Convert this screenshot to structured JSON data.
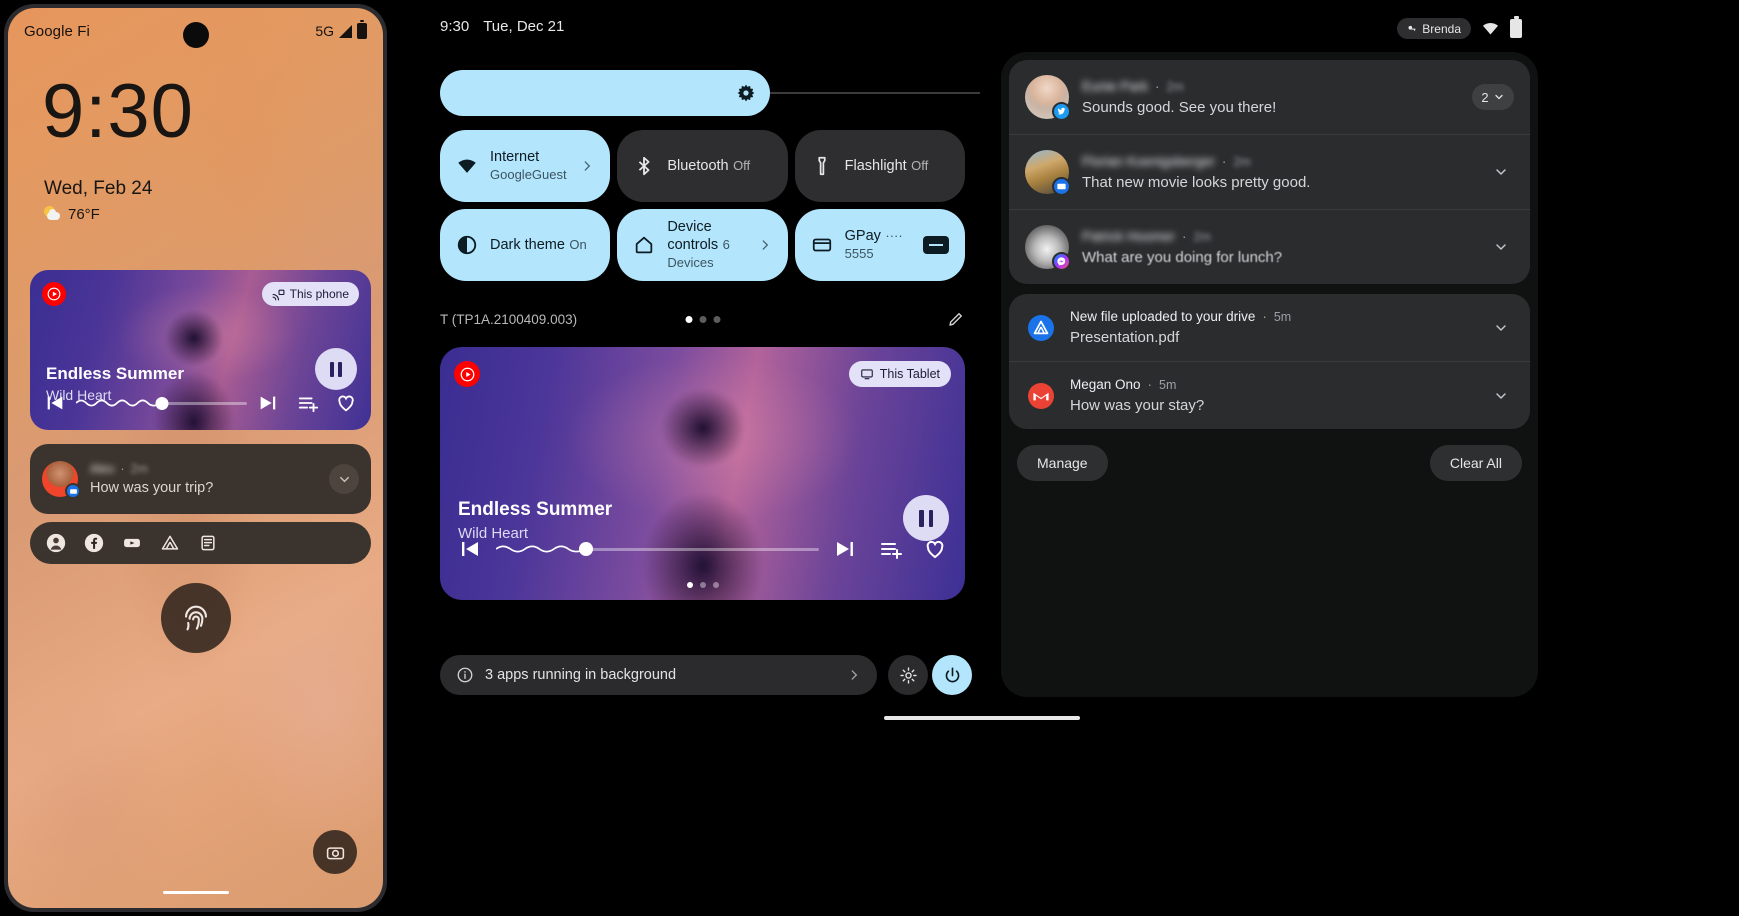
{
  "phone": {
    "status": {
      "carrier": "Google Fi",
      "network": "5G"
    },
    "lock": {
      "time": "9:30",
      "date": "Wed, Feb 24",
      "temperature": "76°F"
    },
    "media": {
      "source_icon": "youtube-music-icon",
      "cast_label": "This phone",
      "title": "Endless Summer",
      "artist": "Wild Heart",
      "play_state": "pause",
      "progress_percent": 50
    },
    "notification": {
      "sender": "Alex",
      "time": "2m",
      "message": "How was your trip?",
      "app_badge": "messages-icon"
    },
    "app_shelf": [
      "headphones-icon",
      "facebook-icon",
      "youtube-icon",
      "drive-icon",
      "keep-icon"
    ],
    "fingerprint_icon": "fingerprint-icon",
    "camera_icon": "camera-icon"
  },
  "tablet": {
    "status": {
      "time": "9:30",
      "date": "Tue, Dec 21"
    },
    "brightness": {
      "icon": "brightness-icon",
      "value_percent": 61
    },
    "tiles": [
      {
        "icon": "wifi-icon",
        "title": "Internet",
        "subtitle": "GoogleGuest",
        "state": "on",
        "has_arrow": true
      },
      {
        "icon": "bluetooth-icon",
        "title": "Bluetooth",
        "subtitle": "Off",
        "state": "off",
        "has_arrow": false
      },
      {
        "icon": "flashlight-icon",
        "title": "Flashlight",
        "subtitle": "Off",
        "state": "off",
        "has_arrow": false
      },
      {
        "icon": "dark-theme-icon",
        "title": "Dark theme",
        "subtitle": "On",
        "state": "on",
        "has_arrow": false
      },
      {
        "icon": "home-icon",
        "title": "Device controls",
        "subtitle": "6 Devices",
        "state": "on",
        "has_arrow": true
      },
      {
        "icon": "credit-card-icon",
        "title": "GPay",
        "subtitle": "···· 5555",
        "state": "on",
        "has_arrow": false
      }
    ],
    "build": "T (TP1A.2100409.003)",
    "page_dots": {
      "count": 3,
      "active": 0
    },
    "edit_icon": "pencil-icon",
    "media": {
      "source_icon": "youtube-music-icon",
      "cast_label": "This Tablet",
      "title": "Endless Summer",
      "artist": "Wild Heart",
      "play_state": "pause",
      "progress_percent": 28,
      "page_dots": {
        "count": 3,
        "active": 0
      }
    },
    "background_apps": {
      "icon": "info-icon",
      "label": "3 apps running in background",
      "arrow": "chevron-right-icon"
    },
    "settings_icon": "gear-icon",
    "power_icon": "power-icon"
  },
  "shade": {
    "status": {
      "user_label": "Brenda",
      "user_icon": "key-icon",
      "wifi_icon": "wifi-icon",
      "battery_icon": "battery-icon"
    },
    "groups": [
      {
        "items": [
          {
            "sender": "Eunie Park",
            "time": "2m",
            "message": "Sounds good. See you there!",
            "app_badge": "twitter-icon",
            "avatar": "photo-woman",
            "blurred_name": true,
            "count_badge": "2",
            "count_chevron": "chevron-down-icon"
          },
          {
            "sender": "Florian Koenigsberger",
            "time": "2m",
            "message": "That new movie looks pretty good.",
            "app_badge": "messages-icon",
            "avatar": "photo-man-desert",
            "blurred_name": true,
            "chevron": "chevron-down-icon"
          },
          {
            "sender": "Patrick Hoomer",
            "time": "2m",
            "message": "What are you doing for lunch?",
            "app_badge": "messenger-icon",
            "avatar": "photo-person-bw",
            "blurred_name": true,
            "chevron": "chevron-down-icon"
          }
        ]
      },
      {
        "items": [
          {
            "sender": "New file uploaded to your drive",
            "time": "5m",
            "message": "Presentation.pdf",
            "app_badge": "drive-icon",
            "blurred_name": false,
            "chevron": "chevron-down-icon"
          },
          {
            "sender": "Megan Ono",
            "time": "5m",
            "message": "How was your stay?",
            "app_badge": "gmail-icon",
            "blurred_name": false,
            "chevron": "chevron-down-icon"
          }
        ]
      }
    ],
    "manage_label": "Manage",
    "clear_all_label": "Clear All"
  },
  "colors": {
    "accent_light_blue": "#b3e5fc",
    "tile_off": "#2e2e30",
    "shade_bg": "#101111",
    "notif_group": "#2b2c2e",
    "phone_wallpaper": "#e0995f",
    "youtube_red": "#ff0000"
  }
}
